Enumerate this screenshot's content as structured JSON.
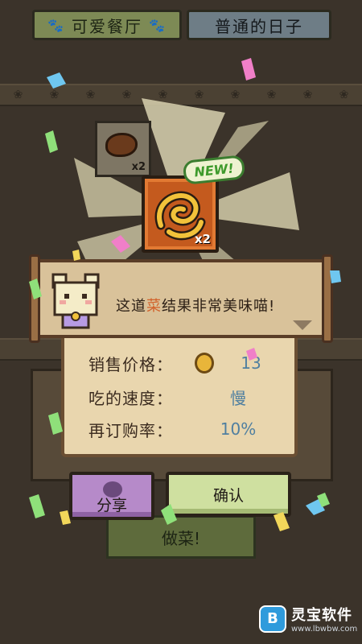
{
  "top_tabs": {
    "left_label": "可爱餐厅",
    "right_label": "普通的日子"
  },
  "reward": {
    "slot_multiplier": "x2",
    "item_multiplier": "x2",
    "new_badge": "NEW!"
  },
  "dialog": {
    "text_before": "这道",
    "highlight": "菜",
    "text_after": "结果非常美味喵!"
  },
  "info": {
    "price_label": "销售价格：",
    "price_value": "13",
    "speed_label": "吃的速度：",
    "speed_value": "慢",
    "reorder_label": "再订购率：",
    "reorder_value": "10%"
  },
  "buttons": {
    "share_label": "分享",
    "confirm_label": "确认",
    "cook_label": "做菜!"
  },
  "watermark": {
    "name": "灵宝软件",
    "url": "www.lbwbw.com"
  },
  "colors": {
    "background": "#3b332a",
    "highlight_text": "#d2612a",
    "value_text": "#4f7fa0",
    "share_button": "#b68ac9",
    "confirm_button": "#cfe0a0"
  }
}
